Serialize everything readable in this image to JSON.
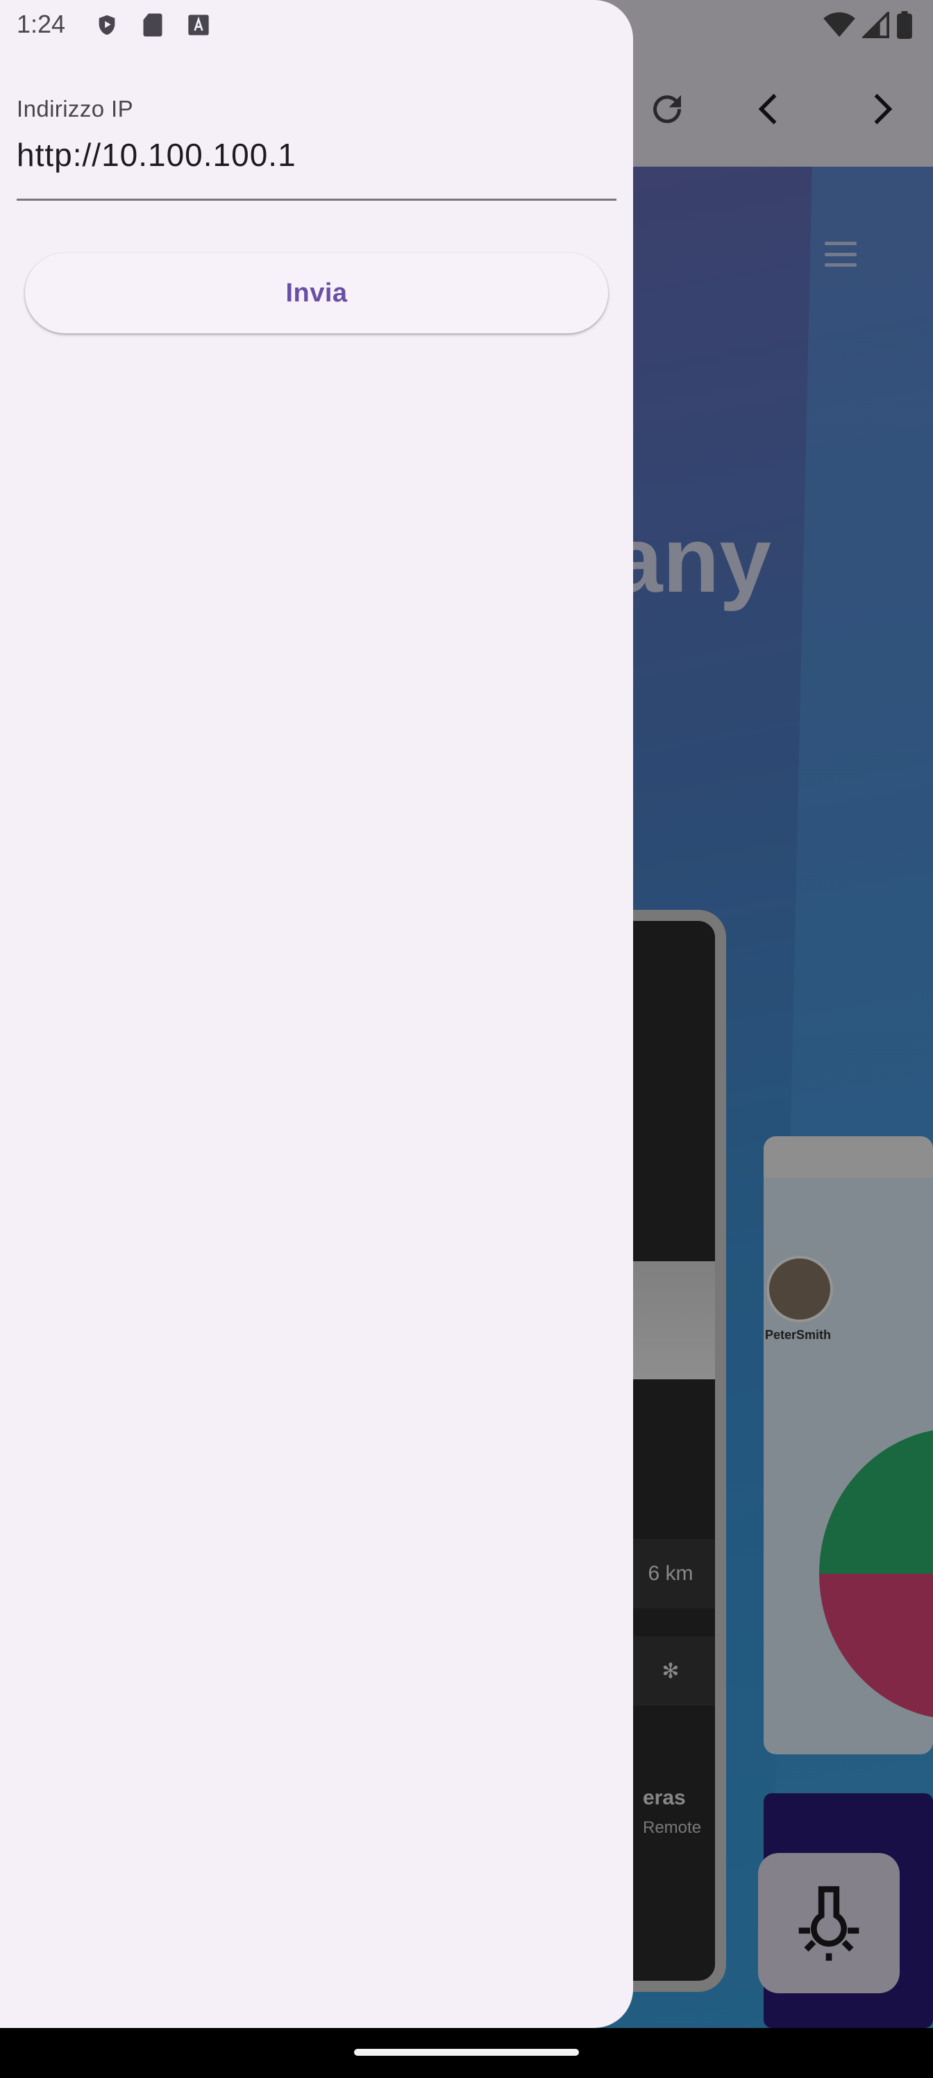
{
  "status_bar": {
    "time": "1:24",
    "left_icons": [
      "shield-play-icon",
      "sd-card-icon",
      "font-a-icon"
    ],
    "right_icons": [
      "wifi-icon",
      "cellular-signal-icon",
      "battery-icon"
    ]
  },
  "drawer": {
    "ip_field": {
      "label": "Indirizzo IP",
      "value": "http://10.100.100.1"
    },
    "send_button_label": "Invia"
  },
  "background_page": {
    "hero_text_fragment": "any",
    "promo_user_name": "PeterSmith",
    "phone_card_value": "6 km",
    "phone_footer_title": "eras",
    "phone_footer_subtitle": "Remote",
    "toolbar_icons": [
      "reload-icon",
      "back-icon",
      "forward-icon"
    ],
    "fab_icon": "light-bulb-icon"
  },
  "colors": {
    "drawer_background": "#f5f0f7",
    "accent": "#6750a4",
    "label": "#49454f",
    "text": "#1d1b20"
  }
}
